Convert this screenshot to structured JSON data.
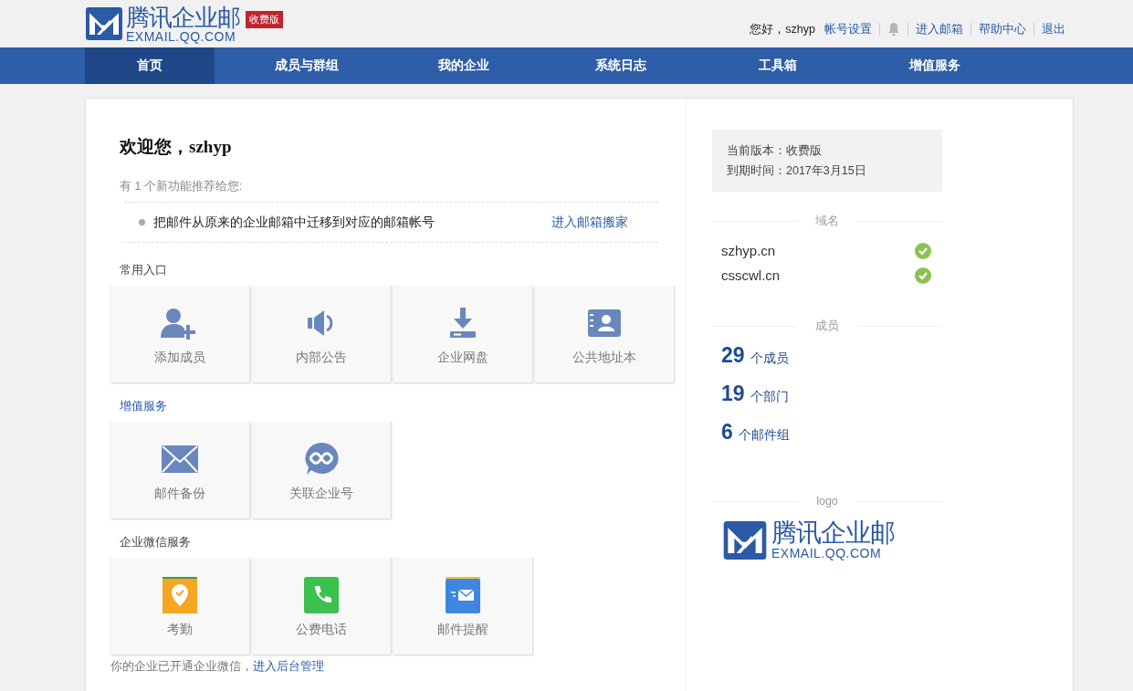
{
  "header": {
    "logo_name": "腾讯企业邮",
    "logo_domain": "EXMAIL.QQ.COM",
    "edition_badge": "收费版",
    "greeting": "您好，szhyp",
    "links": [
      {
        "label": "帐号设置",
        "kind": "text"
      },
      {
        "kind": "bell"
      },
      {
        "label": "进入邮箱",
        "kind": "text"
      },
      {
        "label": "帮助中心",
        "kind": "text"
      },
      {
        "label": "退出",
        "kind": "text"
      }
    ]
  },
  "nav": {
    "tabs": [
      {
        "label": "首页",
        "selected": true
      },
      {
        "label": "成员与群组",
        "selected": false
      },
      {
        "label": "我的企业",
        "selected": false
      },
      {
        "label": "系统日志",
        "selected": false
      },
      {
        "label": "工具箱",
        "selected": false
      },
      {
        "label": "增值服务",
        "selected": false
      }
    ]
  },
  "welcome": {
    "title": "欢迎您，szhyp",
    "recommend_note": "有 1 个新功能推荐给您:",
    "features": [
      {
        "text": "把邮件从原来的企业邮箱中迁移到对应的邮箱帐号",
        "link": "进入邮箱搬家"
      }
    ]
  },
  "sections": [
    {
      "title": "常用入口",
      "highlight": false,
      "tiles": [
        {
          "label": "添加成员"
        },
        {
          "label": "内部公告"
        },
        {
          "label": "企业网盘"
        },
        {
          "label": "公共地址本"
        }
      ]
    },
    {
      "title": "增值服务",
      "highlight": true,
      "tiles": [
        {
          "label": "邮件备份"
        },
        {
          "label": "关联企业号"
        }
      ]
    },
    {
      "title": "企业微信服务",
      "highlight": false,
      "tiles": [
        {
          "label": "考勤"
        },
        {
          "label": "公费电话"
        },
        {
          "label": "邮件提醒"
        }
      ]
    }
  ],
  "footer_note": {
    "text": "你的企业已开通企业微信，",
    "link": "进入后台管理"
  },
  "side": {
    "version_line": "当前版本：收费版",
    "expiry_line": "到期时间：2017年3月15日",
    "domains_heading": "域名",
    "domains": [
      {
        "name": "szhyp.cn",
        "verified": true
      },
      {
        "name": "csscwl.cn",
        "verified": true
      }
    ],
    "members_heading": "成员",
    "stats": [
      {
        "number": "29",
        "unit": "个成员"
      },
      {
        "number": "19",
        "unit": "个部门"
      },
      {
        "number": "6",
        "unit": "个邮件组"
      }
    ],
    "logo_heading": "logo",
    "logo_name": "腾讯企业邮",
    "logo_domain": "EXMAIL.QQ.COM"
  }
}
